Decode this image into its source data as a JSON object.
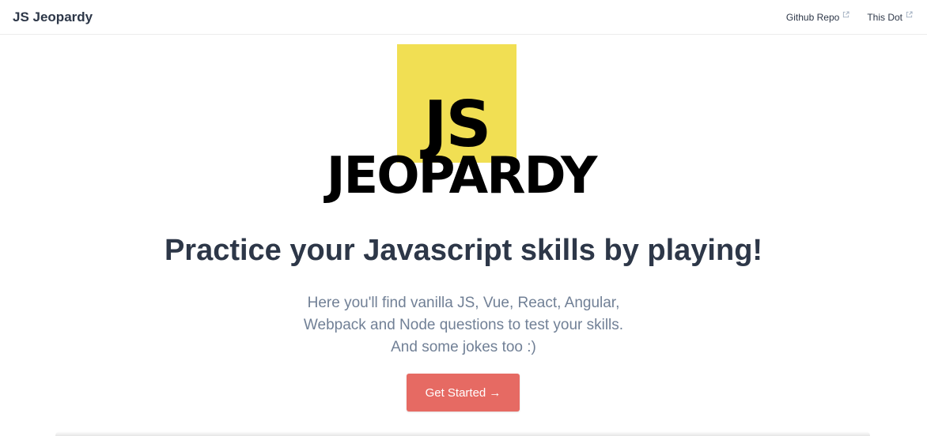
{
  "navbar": {
    "brand": "JS Jeopardy",
    "links": [
      {
        "label": "Github Repo",
        "icon": "external-link-icon"
      },
      {
        "label": "This Dot",
        "icon": "external-link-icon"
      }
    ]
  },
  "logo": {
    "top_text": "JS",
    "bottom_text": "JEOPARDY",
    "accent_color": "#f1df53"
  },
  "hero": {
    "headline": "Practice your Javascript skills by playing!",
    "description_lines": [
      "Here you'll find vanilla JS, Vue, React, Angular,",
      "Webpack and Node questions to test your skills.",
      "And some jokes too :)"
    ],
    "cta_label": "Get Started →",
    "cta_color": "#e66a63"
  }
}
